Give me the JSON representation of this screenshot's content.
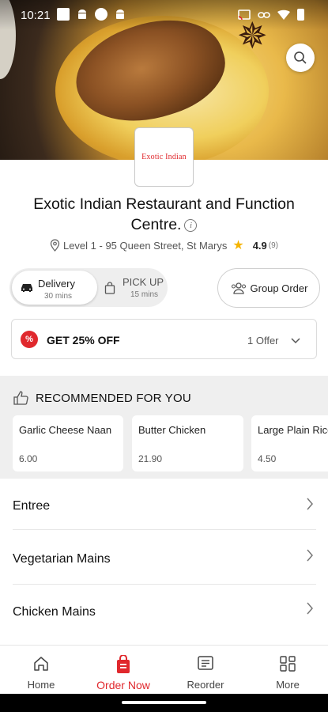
{
  "status_bar": {
    "time": "10:21"
  },
  "restaurant": {
    "logo_text": "Exotic Indian",
    "name": "Exotic Indian Restaurant and Function Centre.",
    "address": "Level 1 - 95 Queen Street, St Marys",
    "rating": "4.9",
    "rating_count": "(9)"
  },
  "order_mode": {
    "delivery_label": "Delivery",
    "delivery_time": "30 mins",
    "pickup_label": "PICK UP",
    "pickup_time": "15 mins",
    "group_order_label": "Group Order"
  },
  "offer": {
    "title": "GET 25% OFF",
    "count": "1 Offer",
    "badge": "%"
  },
  "recommended": {
    "title": "RECOMMENDED FOR YOU",
    "items": [
      {
        "name": "Garlic Cheese Naan",
        "price": "6.00"
      },
      {
        "name": "Butter Chicken",
        "price": "21.90"
      },
      {
        "name": "Large Plain Rice",
        "price": "4.50"
      }
    ]
  },
  "categories": [
    "Entree",
    "Vegetarian Mains",
    "Chicken Mains"
  ],
  "nav": {
    "items": [
      {
        "label": "Home"
      },
      {
        "label": "Order Now"
      },
      {
        "label": "Reorder"
      },
      {
        "label": "More"
      }
    ]
  },
  "colors": {
    "accent": "#e0282d",
    "star": "#f5b400"
  }
}
